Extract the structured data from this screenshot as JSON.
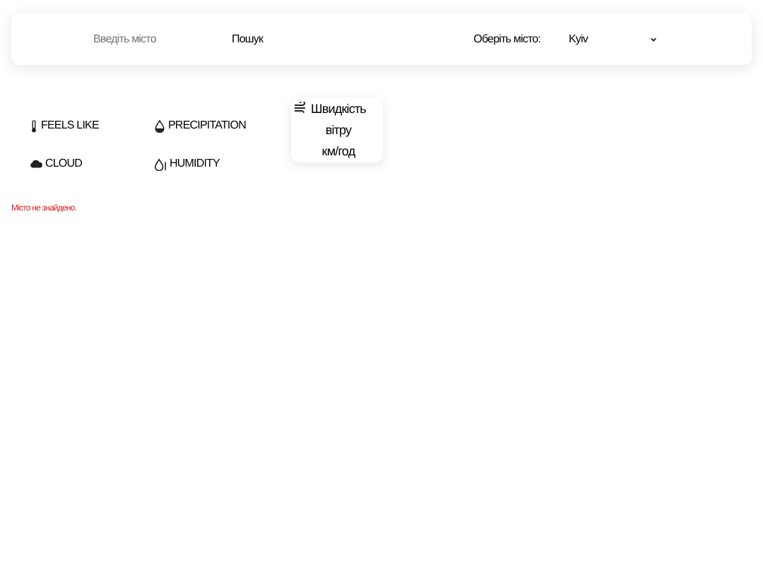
{
  "search": {
    "placeholder": "Введіть місто",
    "button": "Пошук"
  },
  "city_select": {
    "label": "Оберіть місто:",
    "value": "Kyiv"
  },
  "stats": [
    {
      "kind": "thermometer",
      "label": "FEELS LIKE"
    },
    {
      "kind": "drop",
      "label": "PRECIPITATION"
    },
    {
      "kind": "cloud",
      "label": "CLOUD"
    },
    {
      "kind": "humidity",
      "label": "HUMIDITY"
    }
  ],
  "wind_card": {
    "lines": [
      "Швидкість",
      "вітру",
      "км/год"
    ]
  },
  "error": "Місто не знайдено."
}
